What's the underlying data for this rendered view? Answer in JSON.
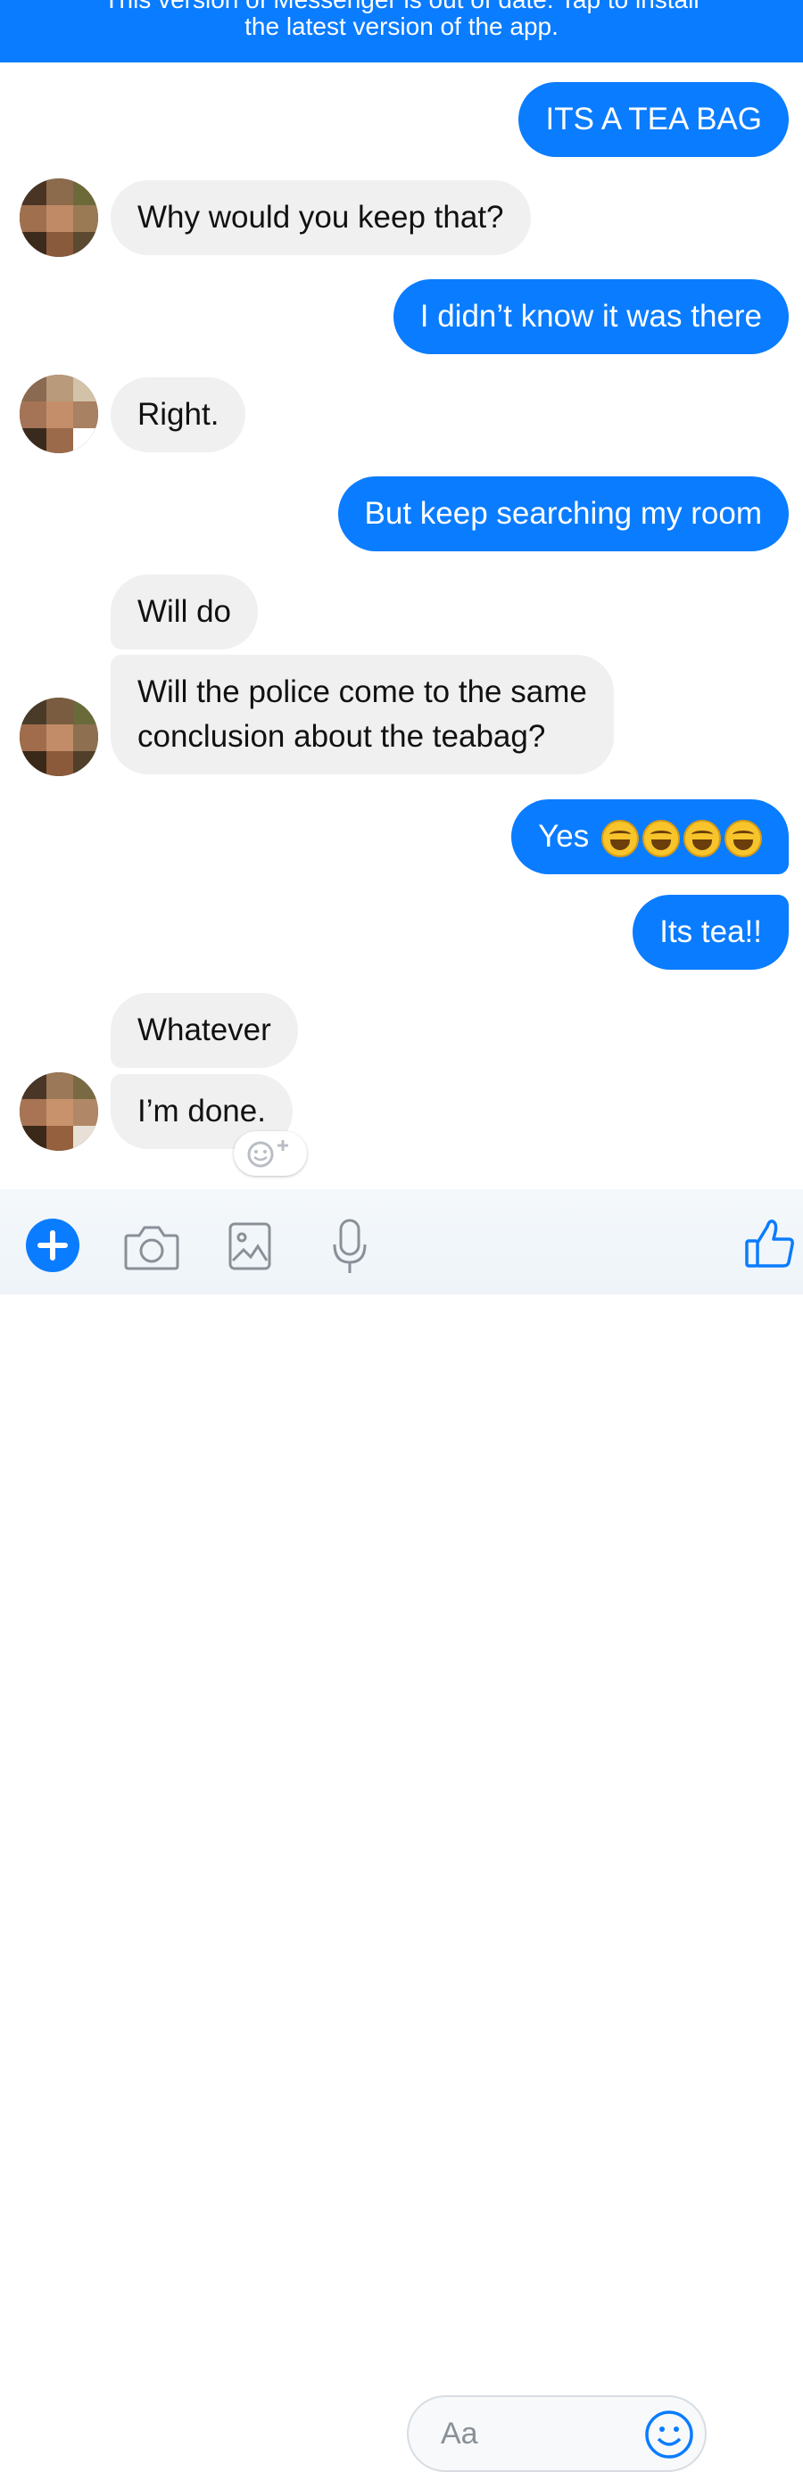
{
  "banner": {
    "line1": "This version of Messenger is out of date. Tap to install",
    "line2": "the latest version of the app."
  },
  "messages": [
    {
      "text": "ITS A TEA BAG"
    },
    {
      "text": "Why would you keep that?"
    },
    {
      "text": "I didn’t know it was there"
    },
    {
      "text": "Right."
    },
    {
      "text": "But keep searching my room"
    },
    {
      "text": "Will do"
    },
    {
      "text": "Will the police come to the same"
    },
    {
      "text": "conclusion about the teabag?"
    },
    {
      "text": "Yes"
    },
    {
      "text": "Its tea!!"
    },
    {
      "text": "Whatever"
    },
    {
      "text": "I’m done."
    }
  ],
  "composer": {
    "placeholder": "Aa"
  },
  "colors": {
    "accent": "#0a7cff",
    "incoming_bubble": "#f0f0f0"
  },
  "icons": [
    "plus-icon",
    "camera-icon",
    "image-icon",
    "microphone-icon",
    "smiley-icon",
    "thumbs-up-icon",
    "add-reaction-icon",
    "laughing-emoji-icon"
  ]
}
